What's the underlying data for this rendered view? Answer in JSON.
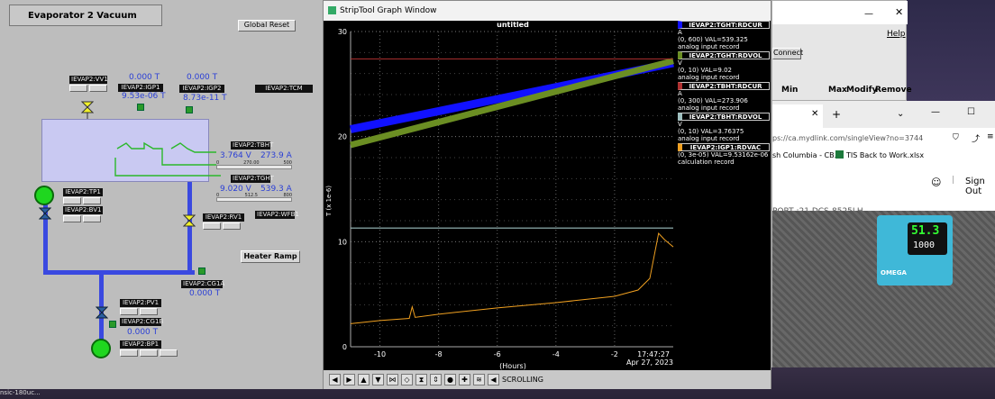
{
  "vacuum": {
    "title": "Evaporator 2 Vacuum",
    "global_reset": "Global Reset",
    "heater_ramp": "Heater Ramp",
    "vv1": "IEVAP2:VV1",
    "igp1": {
      "label": "IEVAP2:IGP1",
      "value": "0.000 T",
      "value2": "9.53e-06 T"
    },
    "igp2": {
      "label": "IEVAP2:IGP2",
      "value": "0.000 T",
      "value2": "8.73e-11 T"
    },
    "tcm": "IEVAP2:TCM",
    "tbht": {
      "label": "IEVAP2:TBHT",
      "v": "3.764 V",
      "a": "273.9 A",
      "scale0": "0",
      "scale1": "270.00",
      "scale2": "500"
    },
    "tght": {
      "label": "IEVAP2:TGHT",
      "v": "9.020 V",
      "a": "539.3 A",
      "scale0": "0",
      "scale1": "512.5",
      "scale2": "800"
    },
    "tp1": "IEVAP2:TP1",
    "bv1": "IEVAP2:BV1",
    "rv1": "IEVAP2:RV1",
    "wfb1": "IEVAP2:WFB1",
    "cg1a": {
      "label": "IEVAP2:CG1A",
      "value": "0.000 T"
    },
    "pv1": "IEVAP2:PV1",
    "cg1b": {
      "label": "IEVAP2:CG1B",
      "value": "0.000 T"
    },
    "bp1": "IEVAP2:BP1"
  },
  "strip": {
    "window_title": "StripTool Graph Window",
    "plot_title": "untitled",
    "ylabel": "T (x 1e-6)",
    "xlabel": "(Hours)",
    "time": "17:47:27",
    "date": "Apr 27, 2023",
    "scroll": "SCROLLING",
    "legend": [
      {
        "name": "IEVAP2:TGHT:RDCUR",
        "unit": "A",
        "range": "(0, 600) VAL=539.325",
        "desc": "analog input record",
        "color": "#1111ff"
      },
      {
        "name": "IEVAP2:TGHT:RDVOL",
        "unit": "V",
        "range": "(0, 10) VAL=9.02",
        "desc": "analog input record",
        "color": "#6b8e23"
      },
      {
        "name": "IEVAP2:TBHT:RDCUR",
        "unit": "A",
        "range": "(0, 300) VAL=273.906",
        "desc": "analog input record",
        "color": "#b03030"
      },
      {
        "name": "IEVAP2:TBHT:RDVOL",
        "unit": "V",
        "range": "(0, 10) VAL=3.76375",
        "desc": "analog input record",
        "color": "#9ec0c0"
      },
      {
        "name": "IEVAP2:IGP1:RDVAC",
        "unit": "",
        "range": "(0, 3e-05) VAL=9.53162e-06",
        "desc": "calculation record",
        "color": "#f0a020"
      }
    ]
  },
  "chart_data": {
    "type": "line",
    "title": "untitled",
    "xlabel": "(Hours)",
    "ylabel": "T (x 1e-6)",
    "xlim": [
      -11,
      0
    ],
    "ylim": [
      0,
      30
    ],
    "x_ticks": [
      -10,
      -8,
      -6,
      -4,
      -2
    ],
    "y_ticks": [
      0,
      10,
      20,
      30
    ],
    "grid": true,
    "series": [
      {
        "name": "IEVAP2:TGHT:RDCUR",
        "color": "#1111ff",
        "x": [
          -11,
          0
        ],
        "y": [
          20.7,
          27.0
        ]
      },
      {
        "name": "IEVAP2:TGHT:RDVOL",
        "color": "#6b8e23",
        "x": [
          -11,
          0
        ],
        "y": [
          19.2,
          27.2
        ]
      },
      {
        "name": "IEVAP2:TBHT:RDCUR",
        "color": "#b03030",
        "x": [
          -11,
          0
        ],
        "y": [
          27.4,
          27.4
        ]
      },
      {
        "name": "IEVAP2:TBHT:RDVOL",
        "color": "#9ec0c0",
        "x": [
          -11,
          0
        ],
        "y": [
          11.3,
          11.3
        ]
      },
      {
        "name": "IEVAP2:IGP1:RDVAC",
        "color": "#f0a020",
        "x": [
          -11,
          -10,
          -9,
          -8.9,
          -8.8,
          -8,
          -6,
          -4,
          -2,
          -1.2,
          -0.8,
          -0.5,
          -0.3,
          0
        ],
        "y": [
          2.2,
          2.5,
          2.7,
          3.8,
          2.8,
          3.1,
          3.7,
          4.2,
          4.8,
          5.4,
          6.5,
          10.8,
          10.2,
          9.5
        ]
      }
    ]
  },
  "small_window": {
    "help": "Help",
    "connect": "Connect",
    "cols": [
      "Min",
      "Max",
      "Modify",
      "Remove"
    ]
  },
  "browser": {
    "url": "ps://ca.mydlink.com/singleView?no=3744",
    "bookmark1": "sh Columbia - CB...",
    "bookmark2": "TIS Back to Work.xlsx",
    "signout": "Sign Out",
    "camera": "PORT :21  DCS-8525LH",
    "display_top": "51.3",
    "display_bottom": "1000",
    "brand": "OMEGA"
  },
  "taskbar_label": "nsic-180uc..."
}
